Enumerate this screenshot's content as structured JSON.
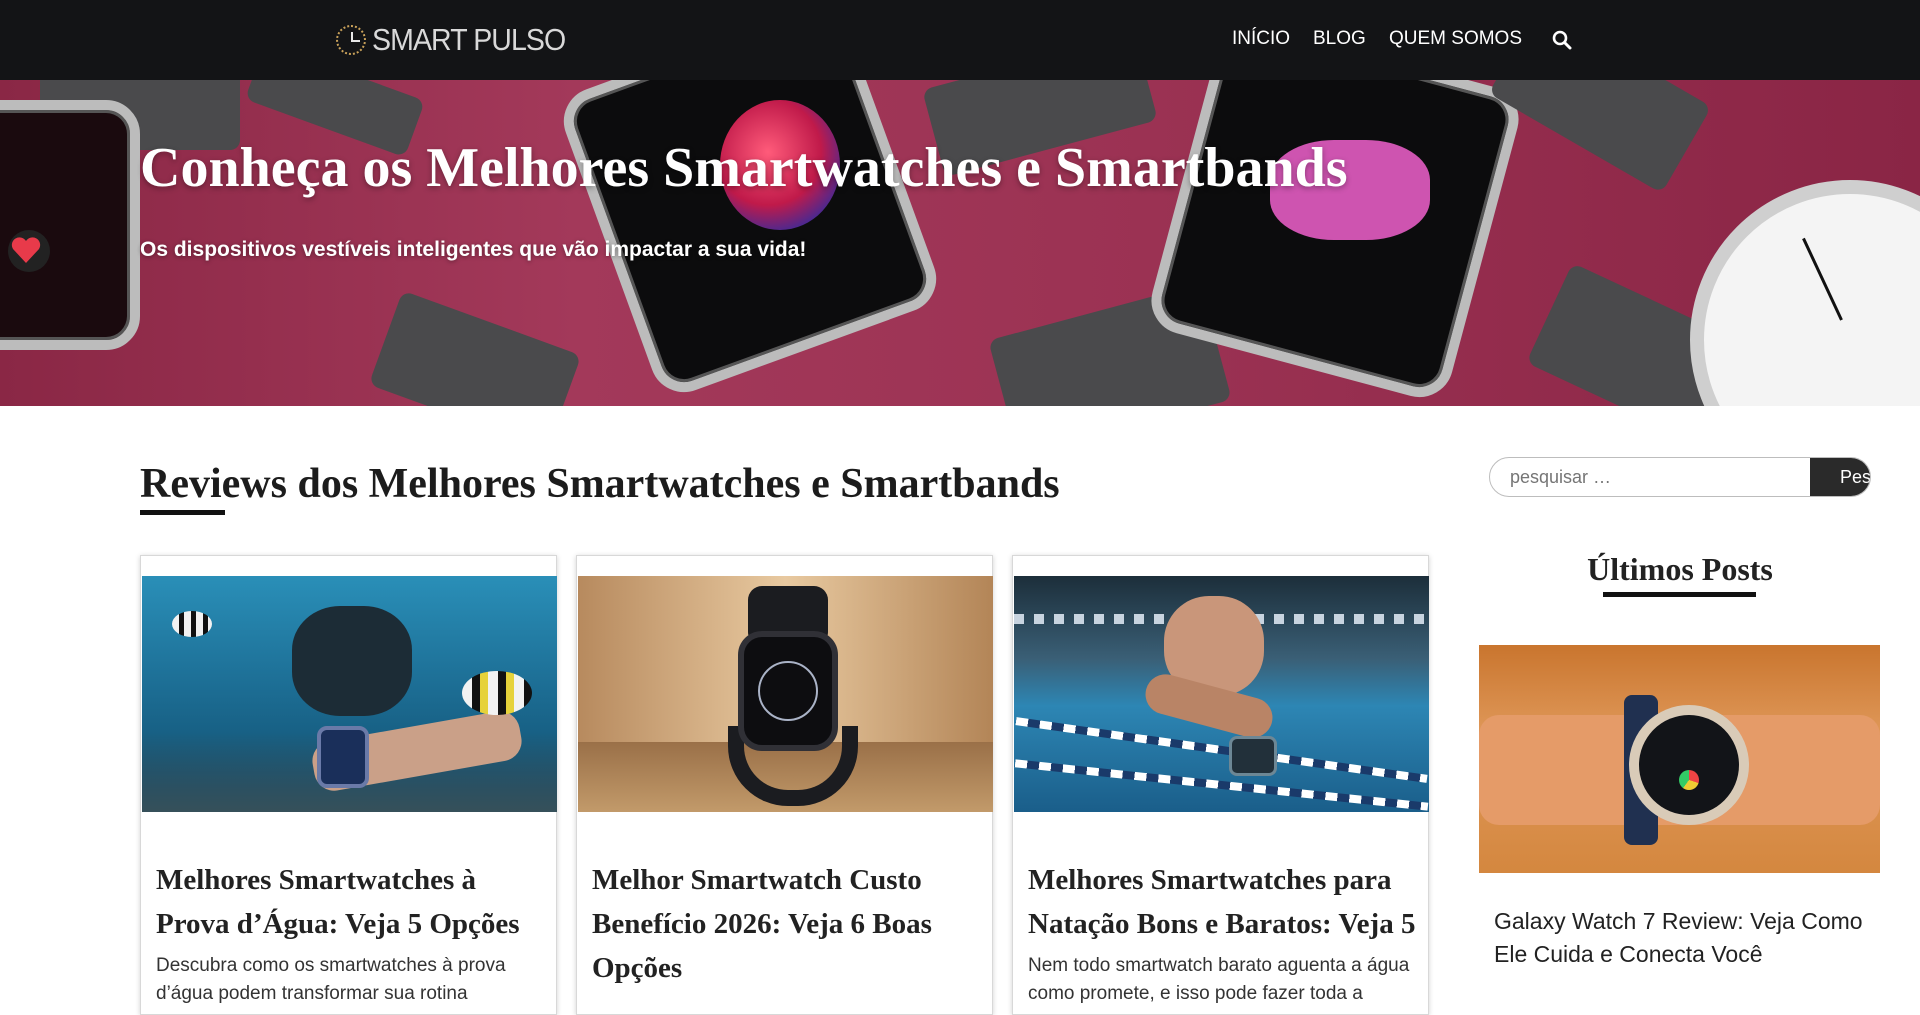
{
  "header": {
    "logo_text": "SMART PULSO",
    "nav": [
      "INÍCIO",
      "BLOG",
      "QUEM SOMOS"
    ],
    "search_icon": "search-icon"
  },
  "hero": {
    "title": "Conheça os Melhores Smartwatches e Smartbands",
    "subtitle": "Os dispositivos vestíveis inteligentes que vão impactar a sua vida!"
  },
  "main": {
    "section_title": "Reviews dos Melhores Smartwatches e Smartbands",
    "cards": [
      {
        "title": "Melhores Smartwatches à Prova d’Água: Veja 5 Opções",
        "excerpt": "Descubra como os smartwatches à prova d’água podem transformar sua rotina"
      },
      {
        "title": "Melhor Smartwatch Custo Benefício 2026: Veja 6 Boas Opções",
        "excerpt": ""
      },
      {
        "title": "Melhores Smartwatches para Natação Bons e Baratos: Veja 5",
        "excerpt": "Nem todo smartwatch barato aguenta a água como promete, e isso pode fazer toda a"
      }
    ]
  },
  "sidebar": {
    "search_placeholder": "pesquisar …",
    "search_button": "Pesquisar",
    "latest_title": "Últimos Posts",
    "latest_post_title": "Galaxy Watch 7 Review: Veja Como Ele Cuida e Conecta Você"
  },
  "colors": {
    "header_bg": "#131416",
    "hero_bg": "#9b3253",
    "accent_dark": "#111111"
  }
}
